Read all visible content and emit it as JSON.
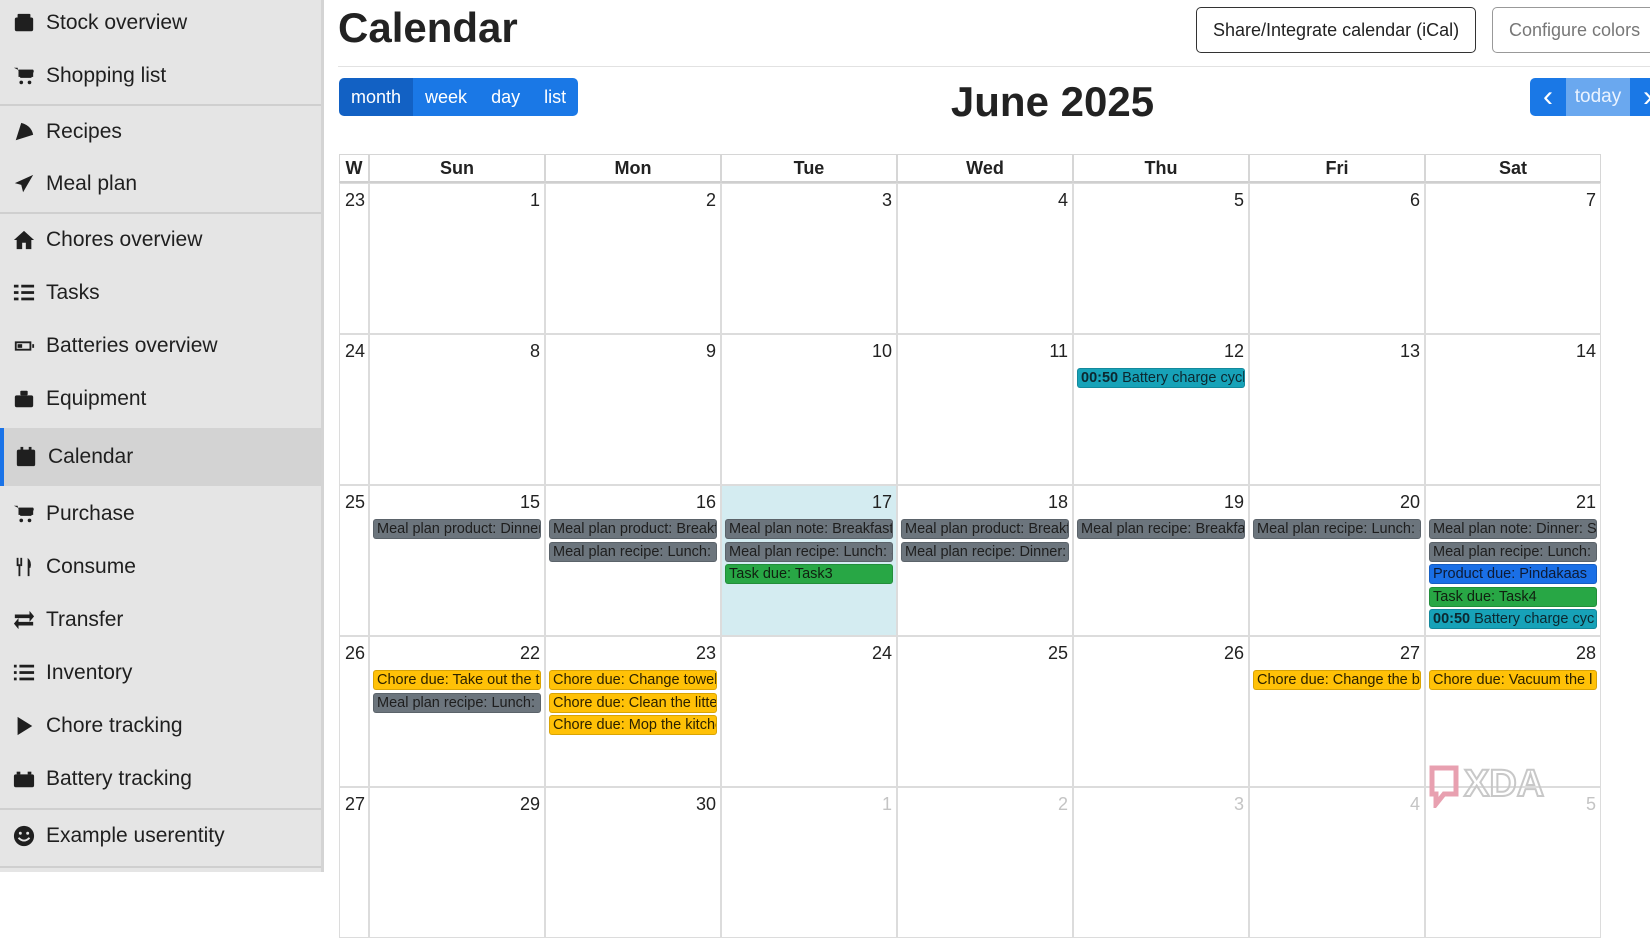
{
  "sidebar": {
    "items": [
      {
        "label": "Stock overview",
        "icon": "box-icon"
      },
      {
        "label": "Shopping list",
        "icon": "cart-icon"
      },
      {
        "label": "Recipes",
        "icon": "pizza-icon"
      },
      {
        "label": "Meal plan",
        "icon": "paper-plane-icon"
      },
      {
        "label": "Chores overview",
        "icon": "home-icon"
      },
      {
        "label": "Tasks",
        "icon": "tasks-icon"
      },
      {
        "label": "Batteries overview",
        "icon": "battery-icon"
      },
      {
        "label": "Equipment",
        "icon": "toolbox-icon"
      },
      {
        "label": "Calendar",
        "icon": "calendar-icon",
        "active": true
      },
      {
        "label": "Purchase",
        "icon": "cart-plus-icon"
      },
      {
        "label": "Consume",
        "icon": "utensils-icon"
      },
      {
        "label": "Transfer",
        "icon": "exchange-icon"
      },
      {
        "label": "Inventory",
        "icon": "list-icon"
      },
      {
        "label": "Chore tracking",
        "icon": "play-icon"
      },
      {
        "label": "Battery tracking",
        "icon": "car-battery-icon"
      },
      {
        "label": "Example userentity",
        "icon": "smile-icon"
      }
    ]
  },
  "header": {
    "title": "Calendar",
    "share_label": "Share/Integrate calendar (iCal)",
    "configure_label": "Configure colors"
  },
  "toolbar": {
    "views": [
      "month",
      "week",
      "day",
      "list"
    ],
    "active_view": "month",
    "title": "June 2025",
    "prev_label": "‹",
    "today_label": "today",
    "next_label": "›"
  },
  "calendar": {
    "week_header": "W",
    "day_headers": [
      "Sun",
      "Mon",
      "Tue",
      "Wed",
      "Thu",
      "Fri",
      "Sat"
    ],
    "weeks": [
      {
        "week": "23",
        "days": [
          {
            "num": "1"
          },
          {
            "num": "2"
          },
          {
            "num": "3"
          },
          {
            "num": "4"
          },
          {
            "num": "5"
          },
          {
            "num": "6"
          },
          {
            "num": "7"
          }
        ]
      },
      {
        "week": "24",
        "days": [
          {
            "num": "8"
          },
          {
            "num": "9"
          },
          {
            "num": "10"
          },
          {
            "num": "11"
          },
          {
            "num": "12",
            "events": [
              {
                "time": "00:50",
                "text": "Battery charge cycl",
                "color": "teal"
              }
            ]
          },
          {
            "num": "13"
          },
          {
            "num": "14"
          }
        ]
      },
      {
        "week": "25",
        "days": [
          {
            "num": "15",
            "events": [
              {
                "text": "Meal plan product: Dinner",
                "color": "gray"
              }
            ]
          },
          {
            "num": "16",
            "events": [
              {
                "text": "Meal plan product: Breakf",
                "color": "gray"
              },
              {
                "text": "Meal plan recipe: Lunch: F",
                "color": "gray"
              }
            ]
          },
          {
            "num": "17",
            "today": true,
            "events": [
              {
                "text": "Meal plan note: Breakfast",
                "color": "gray"
              },
              {
                "text": "Meal plan recipe: Lunch: S",
                "color": "gray"
              },
              {
                "text": "Task due: Task3",
                "color": "green"
              }
            ]
          },
          {
            "num": "18",
            "events": [
              {
                "text": "Meal plan product: Breakf",
                "color": "gray"
              },
              {
                "text": "Meal plan recipe: Dinner: S",
                "color": "gray"
              }
            ]
          },
          {
            "num": "19",
            "events": [
              {
                "text": "Meal plan recipe: Breakfa",
                "color": "gray"
              }
            ]
          },
          {
            "num": "20",
            "events": [
              {
                "text": "Meal plan recipe: Lunch: S",
                "color": "gray"
              }
            ]
          },
          {
            "num": "21",
            "events": [
              {
                "text": "Meal plan note: Dinner: S",
                "color": "gray"
              },
              {
                "text": "Meal plan recipe: Lunch:",
                "color": "gray"
              },
              {
                "text": "Product due: Pindakaas",
                "color": "blue"
              },
              {
                "text": "Task due: Task4",
                "color": "green"
              },
              {
                "time": "00:50",
                "text": "Battery charge cyc",
                "color": "teal"
              }
            ]
          }
        ]
      },
      {
        "week": "26",
        "days": [
          {
            "num": "22",
            "events": [
              {
                "text": "Chore due: Take out the tr",
                "color": "yellow"
              },
              {
                "text": "Meal plan recipe: Lunch: F",
                "color": "gray"
              }
            ]
          },
          {
            "num": "23",
            "events": [
              {
                "text": "Chore due: Change towels",
                "color": "yellow"
              },
              {
                "text": "Chore due: Clean the litter",
                "color": "yellow"
              },
              {
                "text": "Chore due: Mop the kitche",
                "color": "yellow"
              }
            ]
          },
          {
            "num": "24"
          },
          {
            "num": "25"
          },
          {
            "num": "26"
          },
          {
            "num": "27",
            "events": [
              {
                "text": "Chore due: Change the be",
                "color": "yellow"
              }
            ]
          },
          {
            "num": "28",
            "events": [
              {
                "text": "Chore due: Vacuum the l",
                "color": "yellow"
              }
            ]
          }
        ]
      },
      {
        "week": "27",
        "days": [
          {
            "num": "29"
          },
          {
            "num": "30"
          },
          {
            "num": "1",
            "other": true
          },
          {
            "num": "2",
            "other": true
          },
          {
            "num": "3",
            "other": true
          },
          {
            "num": "4",
            "other": true
          },
          {
            "num": "5",
            "other": true
          }
        ]
      }
    ]
  },
  "watermark": "XDA",
  "colors": {
    "primary": "#1a78e6",
    "today_bg": "#d4ecf1",
    "event_gray": "#6c757d",
    "event_green": "#28a745",
    "event_blue": "#1a6fe6",
    "event_teal": "#17a2b8",
    "event_yellow": "#ffc107"
  }
}
